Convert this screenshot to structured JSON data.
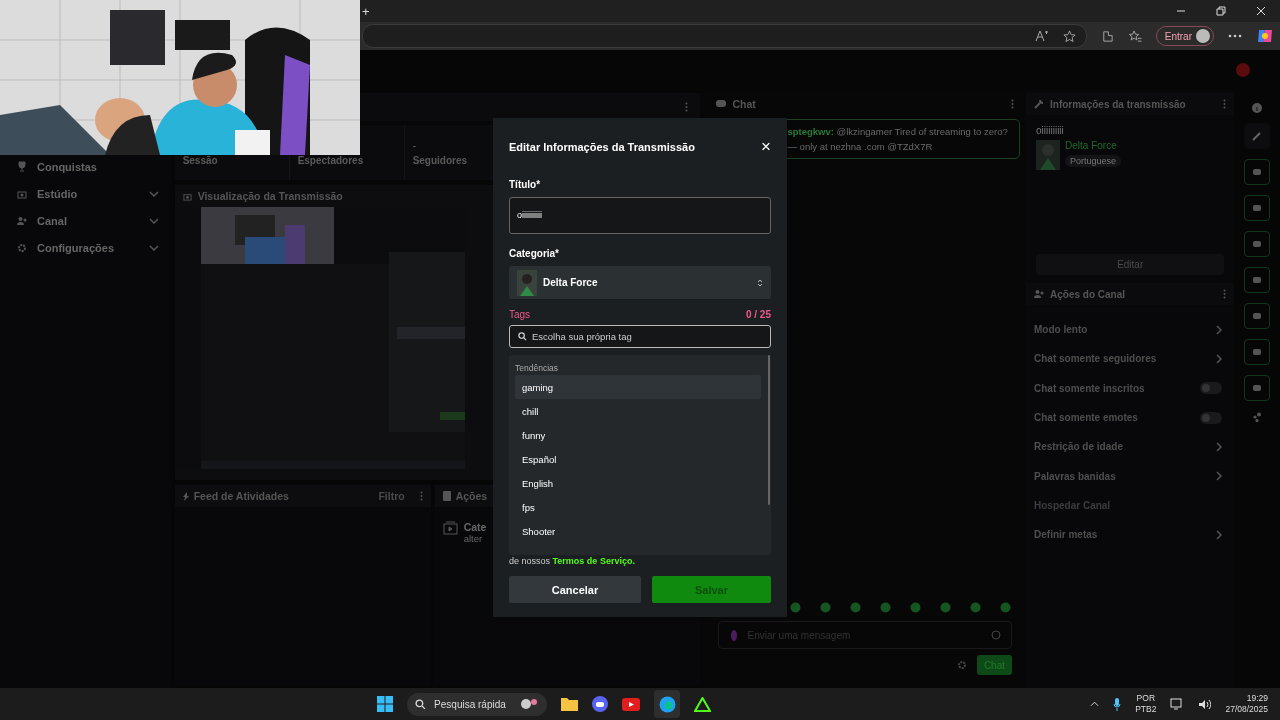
{
  "browser": {
    "new_tab": "+",
    "signin": "Entrar"
  },
  "sidebar": {
    "items": [
      {
        "label": "Conquistas",
        "expandable": false
      },
      {
        "label": "Estúdio",
        "expandable": true
      },
      {
        "label": "Canal",
        "expandable": true
      },
      {
        "label": "Configurações",
        "expandable": true
      }
    ]
  },
  "stats": [
    {
      "label": "Sessão"
    },
    {
      "label": "Espectadores"
    },
    {
      "label": "Seguidores",
      "value": "-"
    }
  ],
  "preview": {
    "title": "Visualização da Transmissão"
  },
  "activity_feed": {
    "title": "Feed de Atividades",
    "filter": "Filtro"
  },
  "actions_panel": {
    "title": "Ações",
    "item_title": "Cate",
    "item_subtitle": "alter"
  },
  "chat": {
    "title": "Chat",
    "message": {
      "user": "sptegkwv:",
      "text": "@lkzingamer Tired of streaming to zero?",
      "line2": "— only at nezhna .com @TZdX7R"
    },
    "input_placeholder": "Enviar uma mensagem",
    "send": "Chat"
  },
  "stream_info": {
    "title": "Informações da transmissão",
    "stream_title": "oiiiiiiiiii",
    "category": "Delta Force",
    "language": "Portuguese",
    "edit": "Editar"
  },
  "channel_actions": {
    "title": "Ações do Canal",
    "items": [
      {
        "label": "Modo lento",
        "kind": "link",
        "disabled": false
      },
      {
        "label": "Chat somente seguidores",
        "kind": "link",
        "disabled": false
      },
      {
        "label": "Chat somente inscritos",
        "kind": "toggle",
        "on": false,
        "disabled": false
      },
      {
        "label": "Chat somente emotes",
        "kind": "toggle",
        "on": false,
        "disabled": false
      },
      {
        "label": "Restrição de idade",
        "kind": "link",
        "disabled": false
      },
      {
        "label": "Palavras banidas",
        "kind": "link",
        "disabled": false
      },
      {
        "label": "Hospedar Canal",
        "kind": "plain",
        "disabled": true
      },
      {
        "label": "Definir metas",
        "kind": "link",
        "disabled": false
      }
    ]
  },
  "modal": {
    "title": "Editar Informações da Transmissão",
    "close": "×",
    "title_label": "Título*",
    "title_value": "oiiiiiiiiii",
    "category_label": "Categoria*",
    "category": "Delta Force",
    "tags": {
      "label": "Tags",
      "count": "0 / 25",
      "placeholder": "Escolha sua própria tag",
      "suggestions_heading": "Tendências",
      "suggestions": [
        {
          "label": "gaming",
          "selected": true
        },
        {
          "label": "chill",
          "selected": false
        },
        {
          "label": "funny",
          "selected": false
        },
        {
          "label": "Español",
          "selected": false
        },
        {
          "label": "English",
          "selected": false
        },
        {
          "label": "fps",
          "selected": false
        },
        {
          "label": "Shooter",
          "selected": false
        }
      ]
    },
    "terms_prefix": "de nossos",
    "terms_link": "Termos de Serviço.",
    "cancel": "Cancelar",
    "save": "Salvar",
    "save_disabled": true
  },
  "taskbar": {
    "search_placeholder": "Pesquisa rápida",
    "language": "POR",
    "layout": "PTB2",
    "time": "19:29",
    "date": "27/08/2025"
  }
}
